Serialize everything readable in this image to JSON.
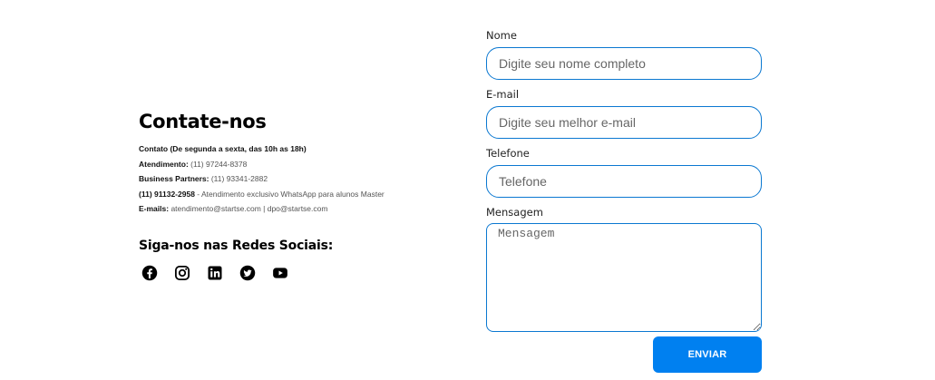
{
  "contact": {
    "title": "Contate-nos",
    "schedule": "Contato (De segunda a sexta, das 10h as 18h)",
    "lines": [
      {
        "label": "Atendimento:",
        "value": " (11) 97244-8378"
      },
      {
        "label": "Business Partners:",
        "value": " (11) 93341-2882"
      },
      {
        "label": "(11) 91132-2958",
        "value": " - Atendimento exclusivo WhatsApp para alunos Master"
      },
      {
        "label": "E-mails:",
        "value": " atendimento@startse.com | dpo@startse.com"
      }
    ]
  },
  "social": {
    "title": "Siga-nos nas Redes Sociais:",
    "icons": [
      "facebook-icon",
      "instagram-icon",
      "linkedin-icon",
      "twitter-icon",
      "youtube-icon"
    ]
  },
  "form": {
    "name": {
      "label": "Nome",
      "placeholder": "Digite seu nome completo"
    },
    "email": {
      "label": "E-mail",
      "placeholder": "Digite seu melhor e-mail"
    },
    "phone": {
      "label": "Telefone",
      "placeholder": "Telefone"
    },
    "message": {
      "label": "Mensagem",
      "placeholder": "Mensagem"
    },
    "submit": "ENVIAR"
  },
  "colors": {
    "accent": "#0080f0",
    "border": "#0b78d1"
  }
}
